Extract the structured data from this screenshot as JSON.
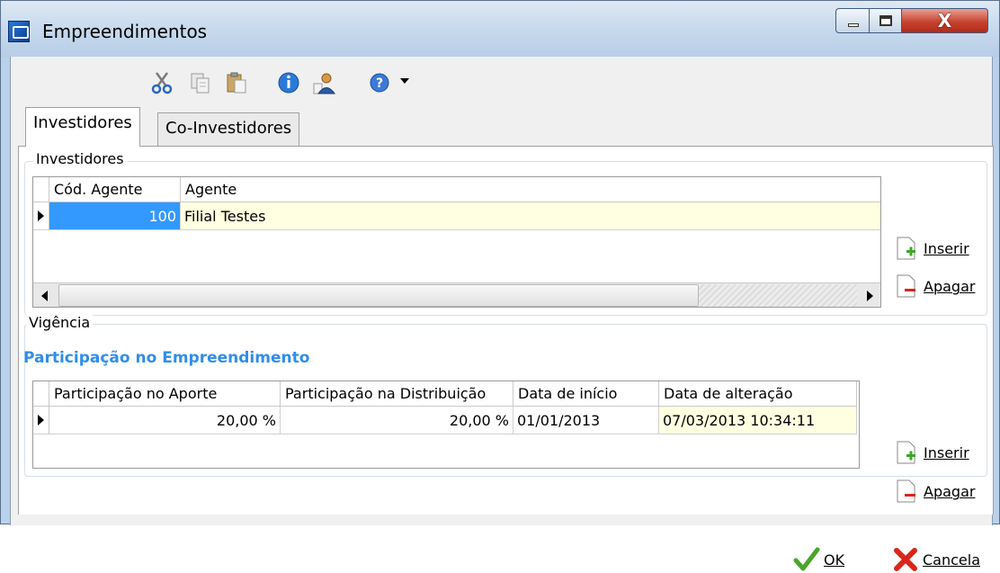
{
  "window": {
    "title": "Empreendimentos",
    "close_glyph": "X"
  },
  "toolbar": {
    "icons": [
      "cut-icon",
      "copy-icon",
      "paste-icon",
      "info-icon",
      "user-icon",
      "help-icon",
      "dropdown-arrow-icon"
    ]
  },
  "tabs": [
    {
      "label": "Investidores",
      "active": true
    },
    {
      "label": "Co-Investidores",
      "active": false
    }
  ],
  "investidores": {
    "group_label": "Investidores",
    "columns": [
      "Cód. Agente",
      "Agente"
    ],
    "rows": [
      {
        "cod_agente": "100",
        "agente": "Filial Testes"
      }
    ],
    "buttons": {
      "insert": "Inserir",
      "delete": "Apagar"
    }
  },
  "vigencia": {
    "group_label": "Vigência",
    "heading": "Participação no Empreendimento",
    "columns": [
      "Participação no Aporte",
      "Participação na Distribuição",
      "Data de início",
      "Data de alteração"
    ],
    "rows": [
      {
        "aporte": "20,00 %",
        "distribuicao": "20,00 %",
        "data_inicio": "01/01/2013",
        "data_alteracao": "07/03/2013 10:34:11"
      }
    ],
    "buttons": {
      "insert": "Inserir",
      "delete": "Apagar"
    }
  },
  "footer": {
    "ok": "OK",
    "cancel": "Cancela"
  },
  "colors": {
    "selection": "#3399ff",
    "highlight_cell": "#ffffe1",
    "heading": "#2f8ee8",
    "ok_check": "#4aa52a",
    "cancel_x": "#d9261c"
  }
}
